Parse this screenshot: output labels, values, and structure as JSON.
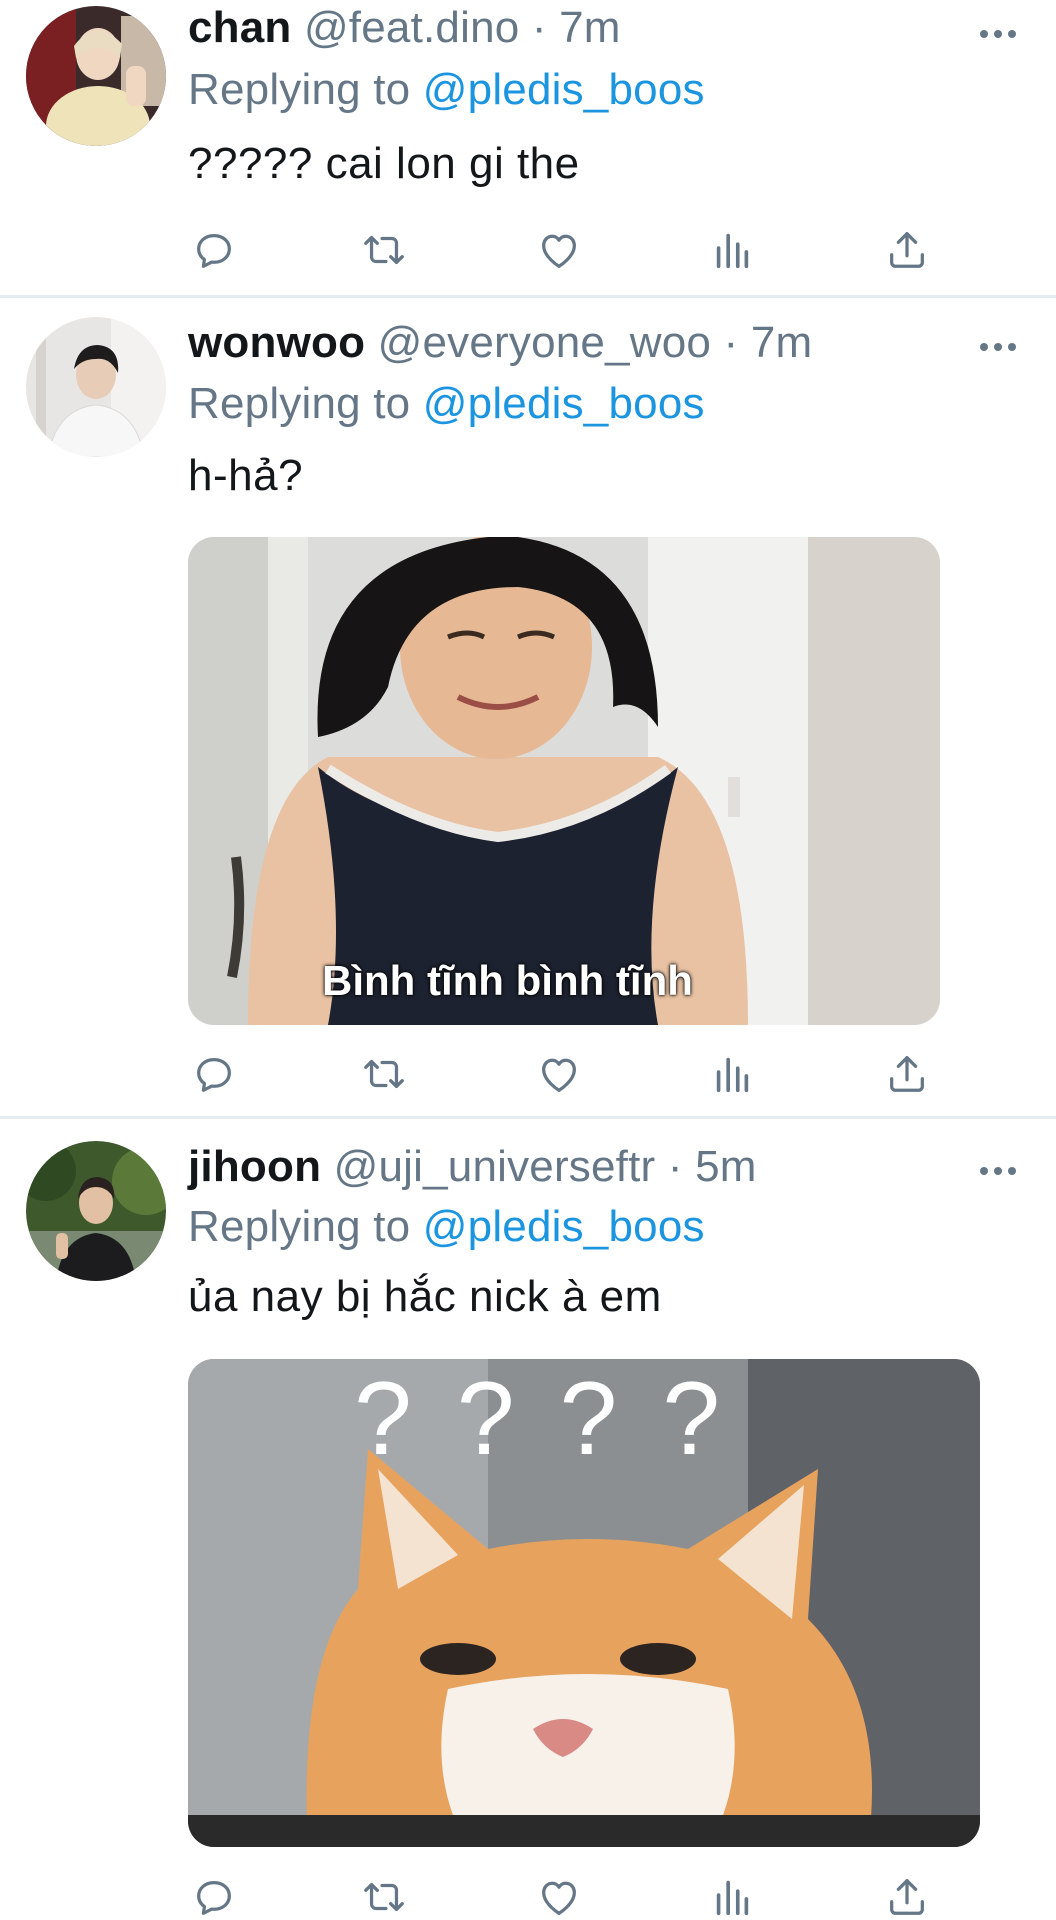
{
  "tweets": [
    {
      "name": "chan",
      "handle": "@feat.dino",
      "separator": "·",
      "time": "7m",
      "replying_prefix": "Replying to",
      "replying_to": "@pledis_boos",
      "text": "????? cai lon gi the"
    },
    {
      "name": "wonwoo",
      "handle": "@everyone_woo",
      "separator": "·",
      "time": "7m",
      "replying_prefix": "Replying to",
      "replying_to": "@pledis_boos",
      "text": "h-hả?",
      "media_caption": "Bình tĩnh bình tĩnh"
    },
    {
      "name": "jihoon",
      "handle": "@uji_universeftr",
      "separator": "·",
      "time": "5m",
      "replying_prefix": "Replying to",
      "replying_to": "@pledis_boos",
      "text": "ủa nay bị hắc nick à em",
      "media_caption": "? ? ? ?"
    }
  ],
  "icons": {
    "reply": "reply-icon",
    "retweet": "retweet-icon",
    "like": "heart-icon",
    "stats": "analytics-icon",
    "share": "share-icon",
    "more": "more-icon"
  },
  "colors": {
    "text": "#14171a",
    "secondary": "#657786",
    "link": "#1b95e0",
    "divider": "#e6ecf0"
  }
}
